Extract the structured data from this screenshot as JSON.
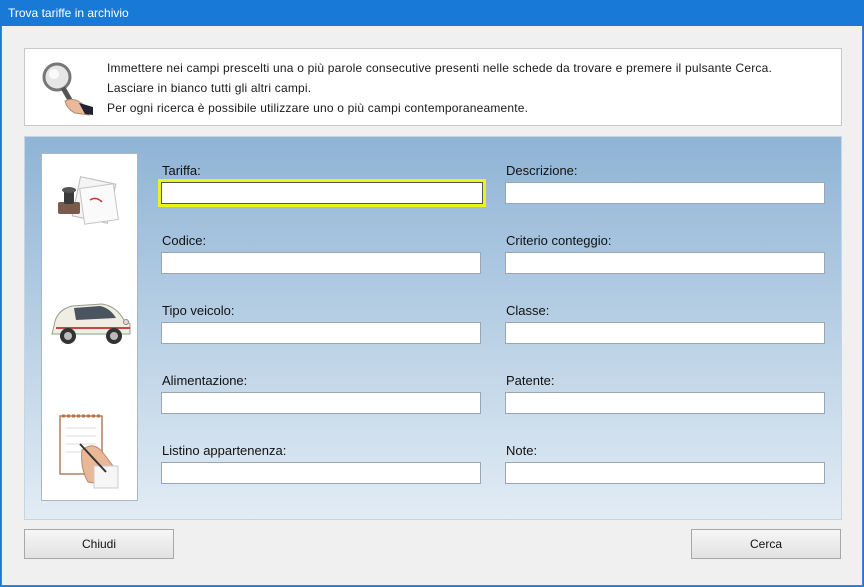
{
  "window": {
    "title": "Trova tariffe in archivio"
  },
  "info": {
    "lines": [
      "Immettere nei campi prescelti una o più parole consecutive presenti nelle schede da trovare e premere il pulsante Cerca.",
      "Lasciare in bianco tutti gli altri campi.",
      "Per ogni ricerca è possibile utilizzare uno o più campi contemporaneamente."
    ]
  },
  "fields": {
    "tariffa": {
      "label": "Tariffa:",
      "value": ""
    },
    "descrizione": {
      "label": "Descrizione:",
      "value": ""
    },
    "codice": {
      "label": "Codice:",
      "value": ""
    },
    "criterio": {
      "label": "Criterio conteggio:",
      "value": ""
    },
    "tipo_veicolo": {
      "label": "Tipo veicolo:",
      "value": ""
    },
    "classe": {
      "label": "Classe:",
      "value": ""
    },
    "alimentazione": {
      "label": "Alimentazione:",
      "value": ""
    },
    "patente": {
      "label": "Patente:",
      "value": ""
    },
    "listino": {
      "label": "Listino appartenenza:",
      "value": ""
    },
    "note": {
      "label": "Note:",
      "value": ""
    }
  },
  "buttons": {
    "close_label": "Chiudi",
    "search_label": "Cerca"
  },
  "icons": [
    "magnifier-hand-icon",
    "stamp-documents-icon",
    "car-icon",
    "writing-notepad-icon"
  ],
  "colors": {
    "titlebar": "#1979d7",
    "focus_border": "#f0f01e",
    "panel_top": "#8fb4d6",
    "panel_bottom": "#e2ecf5"
  }
}
